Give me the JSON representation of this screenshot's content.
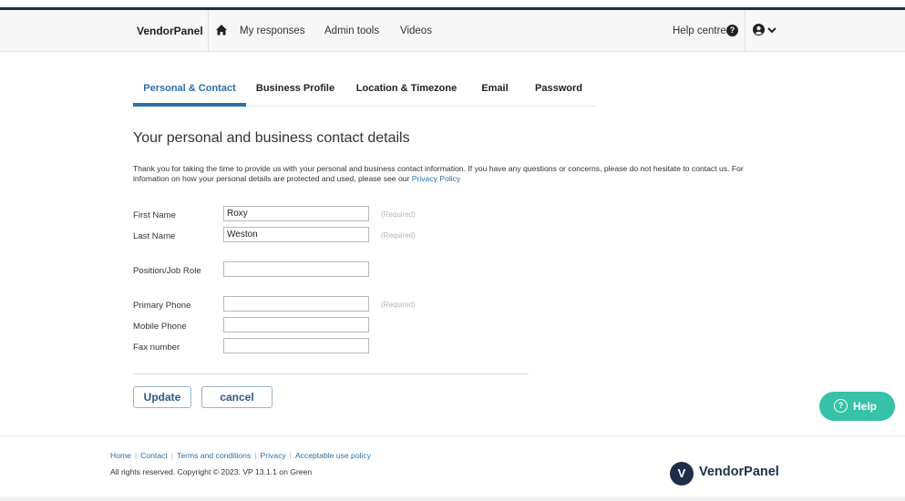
{
  "nav": {
    "brand": "VendorPanel",
    "links": [
      "My responses",
      "Admin tools",
      "Videos"
    ],
    "help": "Help centre"
  },
  "tabs": [
    "Personal & Contact",
    "Business Profile",
    "Location & Timezone",
    "Email",
    "Password"
  ],
  "active_tab": "Personal & Contact",
  "title": "Your personal and business contact details",
  "intro": {
    "text": "Thank you for taking the time to provide us with your personal and business contact information. If you have any questions or concerns, please do not hesitate to contact us. For infomation on how your personal details are protected and used, please see our ",
    "link": "Privacy Policy"
  },
  "form": {
    "first_name": {
      "label": "First Name",
      "value": "Roxy",
      "hint": "(Required)"
    },
    "last_name": {
      "label": "Last Name",
      "value": "Weston",
      "hint": "(Required)"
    },
    "position": {
      "label": "Position/Job Role",
      "value": ""
    },
    "primary_phone": {
      "label": "Primary Phone",
      "value": "",
      "hint": "(Required)"
    },
    "mobile_phone": {
      "label": "Mobile Phone",
      "value": ""
    },
    "fax": {
      "label": "Fax number",
      "value": ""
    }
  },
  "buttons": {
    "update": "Update",
    "cancel": "cancel"
  },
  "help_widget": "Help",
  "footer": {
    "links": [
      "Home",
      "Contact",
      "Terms and conditions",
      "Privacy",
      "Acceptable use policy"
    ],
    "copyright": "All rights reserved. Copyright © 2023. VP 13.1.1 on Green",
    "brand": "VendorPanel"
  },
  "colors": {
    "accent": "#2a6fa8",
    "help_widget": "#36c2a7",
    "dark_brand": "#1d2e4a"
  }
}
